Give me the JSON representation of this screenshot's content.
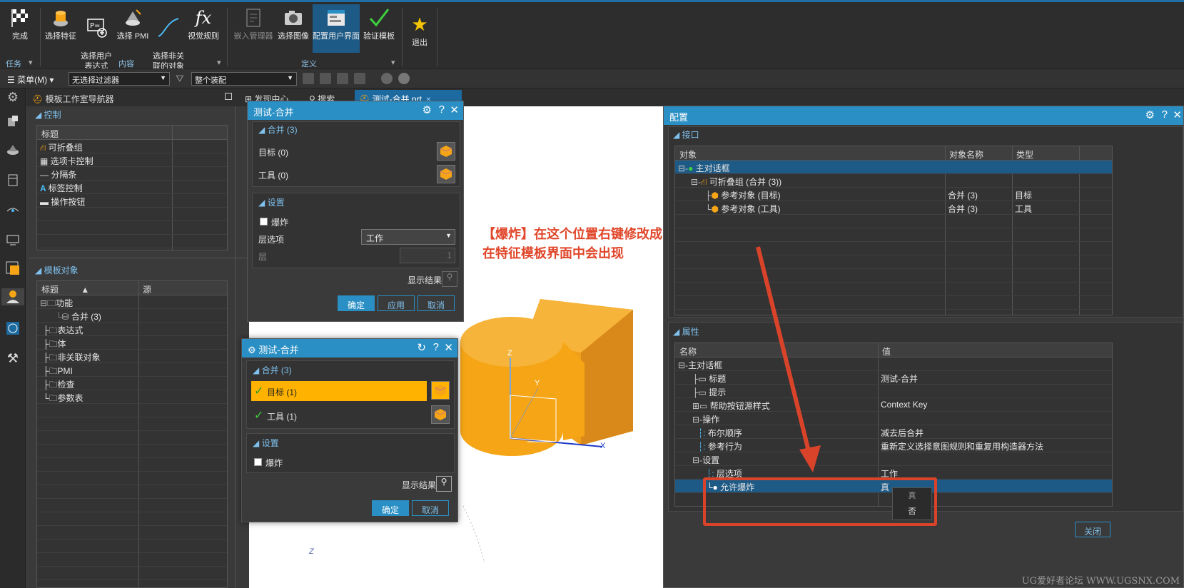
{
  "ribbon": {
    "buttons": [
      {
        "label": "完成",
        "icon": "checkered-flag-icon"
      },
      {
        "label": "选择特征",
        "icon": "select-feature-icon"
      },
      {
        "label": "选择用户\n表达式",
        "icon": "user-expression-icon"
      },
      {
        "label": "选择 PMI",
        "icon": "pmi-icon"
      },
      {
        "label": "选择非关\n联的对象",
        "icon": "curve-icon"
      },
      {
        "label": "视觉规则",
        "icon": "fx-icon"
      },
      {
        "label": "嵌入管理器",
        "icon": "embed-manager-icon"
      },
      {
        "label": "选择图像",
        "icon": "camera-icon"
      },
      {
        "label": "配置用户界面",
        "icon": "configure-ui-icon"
      },
      {
        "label": "验证模板",
        "icon": "checkmark-icon"
      },
      {
        "label": "退出",
        "icon": "star-icon"
      }
    ],
    "groups": [
      "任务",
      "内容",
      "定义"
    ]
  },
  "toolbar": {
    "menu_label": "菜单(M)",
    "filter": "无选择过滤器",
    "assembly": "整个装配"
  },
  "tabs": {
    "navigator": "模板工作室导航器",
    "discover": "发现中心",
    "search": "搜索",
    "part": "测试-合并.prt"
  },
  "navigator": {
    "control_section": "控制",
    "control_header": "标题",
    "control_items": [
      "可折叠组",
      "选项卡控制",
      "分隔条",
      "标签控制",
      "操作按钮"
    ],
    "objects_section": "模板对象",
    "objects_headers": [
      "标题",
      "源"
    ],
    "objects_items": [
      "功能",
      "合并 (3)",
      "表达式",
      "体",
      "非关联对象",
      "PMI",
      "检查",
      "参数表"
    ]
  },
  "dialog1": {
    "title": "测试-合并",
    "group": "合并 (3)",
    "target": "目标 (0)",
    "tool": "工具 (0)",
    "settings": "设置",
    "explode": "爆炸",
    "layer_option_label": "层选项",
    "layer_option_value": "工作",
    "layer_label": "层",
    "layer_value": "1",
    "show_result": "显示结果",
    "ok": "确定",
    "apply": "应用",
    "cancel": "取消"
  },
  "dialog2": {
    "title": "测试-合并",
    "group": "合并 (3)",
    "target": "目标 (1)",
    "tool": "工具 (1)",
    "settings": "设置",
    "explode": "爆炸",
    "show_result": "显示结果",
    "ok": "确定",
    "cancel": "取消"
  },
  "annotation": {
    "line1": "【爆炸】在这个位置右键修改成【真】之后，",
    "line2": "在特征模板界面中会出现"
  },
  "viewport": {
    "axis_z": "Z",
    "axis_y": "Y",
    "axis_x": "X",
    "bottom_z": "Z"
  },
  "config": {
    "title": "配置",
    "interface_section": "接口",
    "interface_headers": [
      "对象",
      "对象名称",
      "类型"
    ],
    "interface_rows": [
      {
        "obj": "主对话框",
        "name": "",
        "type": ""
      },
      {
        "obj": "可折叠组 (合并 (3))",
        "name": "",
        "type": ""
      },
      {
        "obj": "参考对象 (目标)",
        "name": "合并 (3)",
        "type": "目标"
      },
      {
        "obj": "参考对象 (工具)",
        "name": "合并 (3)",
        "type": "工具"
      }
    ],
    "props_section": "属性",
    "props_headers": [
      "名称",
      "值"
    ],
    "props_rows": [
      {
        "name": "主对话框",
        "value": ""
      },
      {
        "name": "标题",
        "value": "测试-合并"
      },
      {
        "name": "提示",
        "value": ""
      },
      {
        "name": "帮助按钮源样式",
        "value": "Context Key"
      },
      {
        "name": "操作",
        "value": ""
      },
      {
        "name": "布尔顺序",
        "value": "减去后合并"
      },
      {
        "name": "参考行为",
        "value": "重新定义选择意图规则和重复用构造器方法"
      },
      {
        "name": "设置",
        "value": ""
      },
      {
        "name": "层选项",
        "value": "工作"
      },
      {
        "name": "允许爆炸",
        "value": "真"
      }
    ],
    "context_menu": [
      "真",
      "否"
    ],
    "close": "关闭"
  },
  "watermark": "UG爱好者论坛 WWW.UGSNX.COM",
  "colors": {
    "accent": "#2a8fc4",
    "orange": "#f5a516",
    "annotation": "#e0462a"
  }
}
